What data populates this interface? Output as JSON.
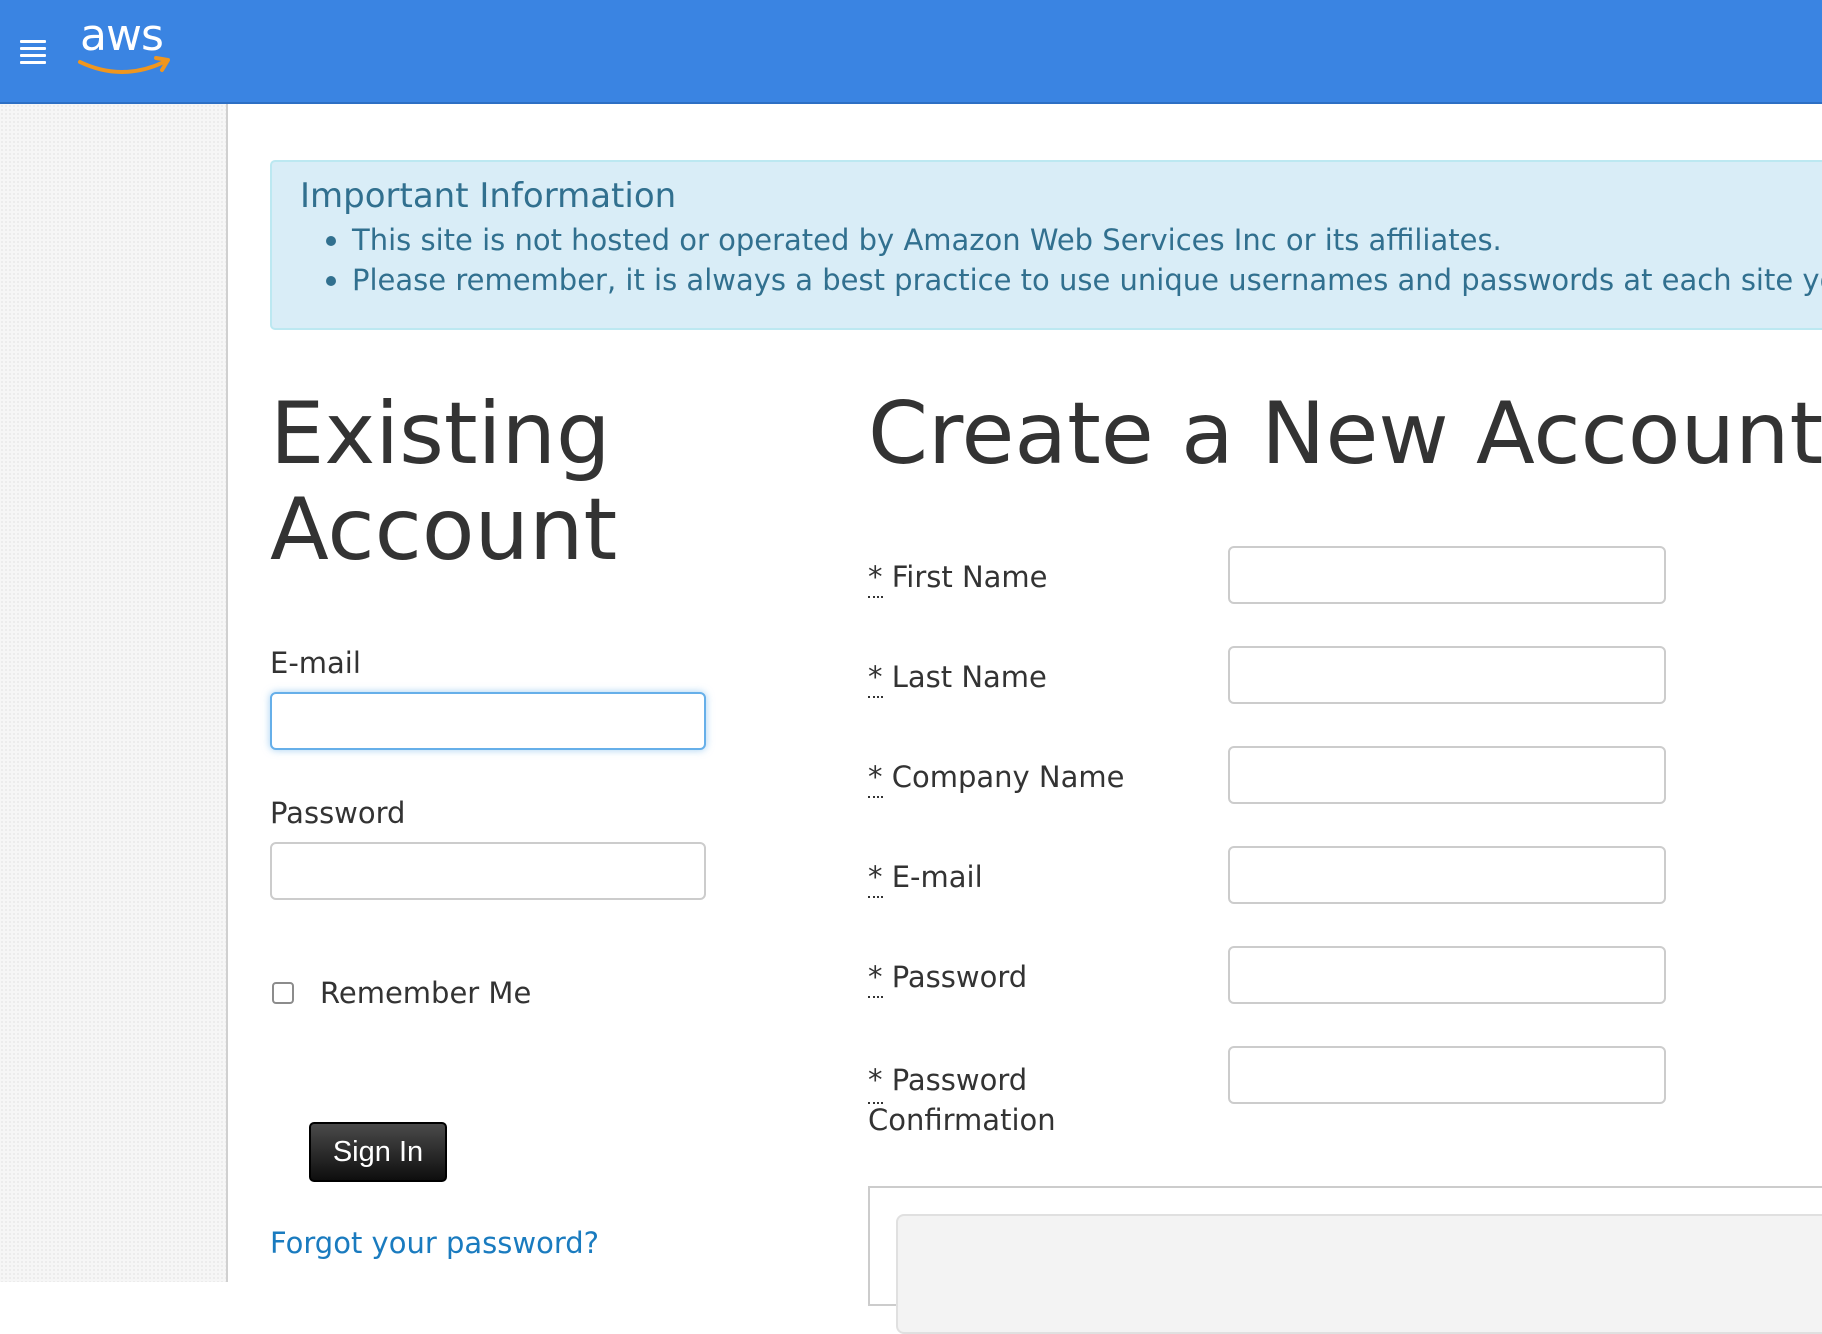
{
  "header": {
    "menu_icon": "hamburger-menu-icon",
    "logo_text": "aws",
    "logo_smile_color": "#f0961e",
    "bar_color": "#3a84e2"
  },
  "info": {
    "title": "Important Information",
    "items": [
      "This site is not hosted or operated by Amazon Web Services Inc or its affiliates.",
      "Please remember, it is always a best practice to use unique usernames and passwords at each site you u"
    ]
  },
  "existing": {
    "heading_line1": "Existing",
    "heading_line2": "Account",
    "email_label": "E-mail",
    "email_value": "",
    "password_label": "Password",
    "password_value": "",
    "remember_label": "Remember Me",
    "remember_checked": false,
    "signin_label": "Sign In",
    "forgot_link": "Forgot your password?"
  },
  "create": {
    "heading": "Create a New Account",
    "required_marker": "*",
    "fields": [
      {
        "label": "First Name",
        "value": ""
      },
      {
        "label": "Last Name",
        "value": ""
      },
      {
        "label": "Company Name",
        "value": ""
      },
      {
        "label": "E-mail",
        "value": ""
      },
      {
        "label": "Password",
        "value": ""
      },
      {
        "label": "Password",
        "label_line2": "Confirmation",
        "value": ""
      }
    ]
  }
}
